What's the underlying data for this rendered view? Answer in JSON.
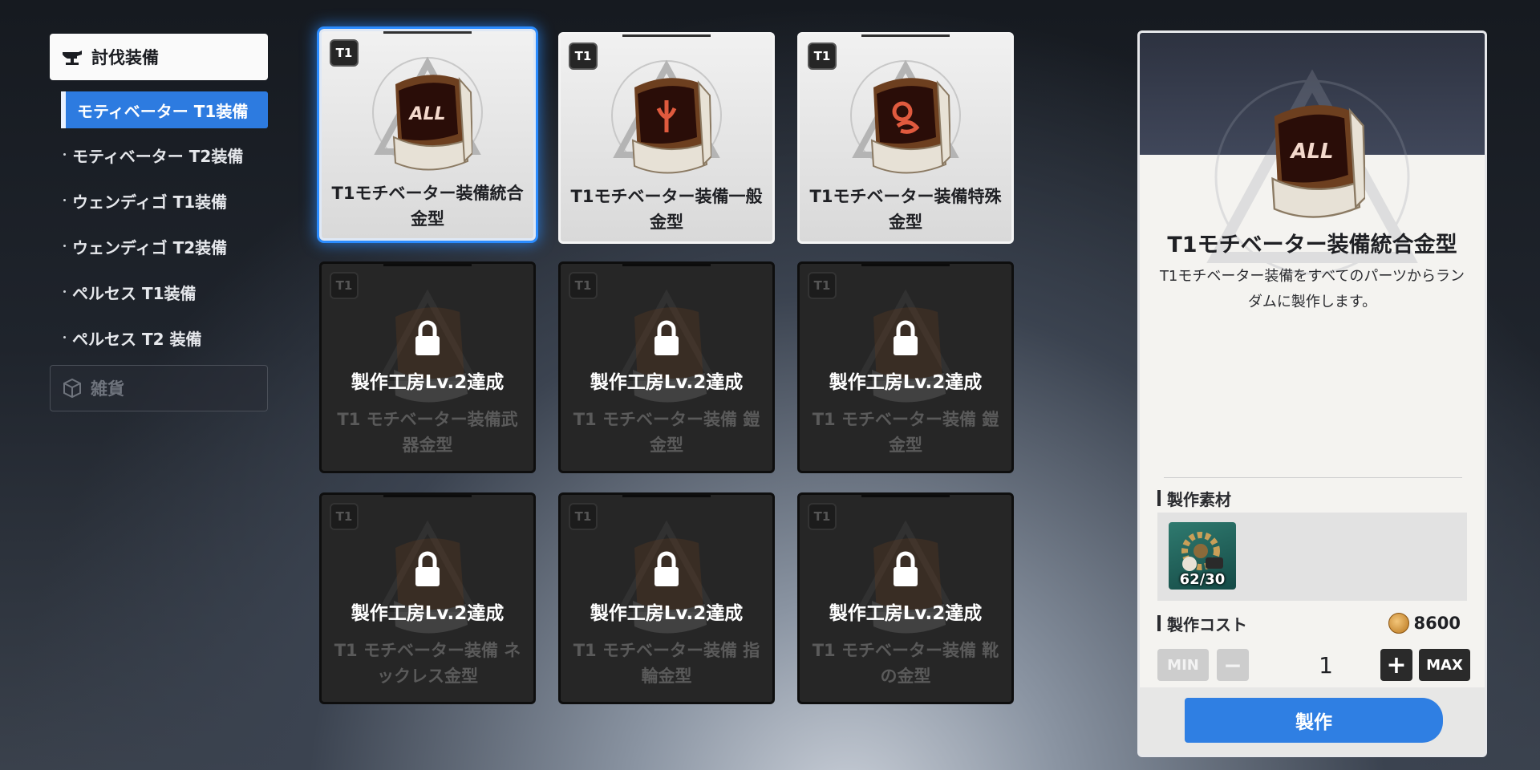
{
  "sidebar": {
    "category_active": "討伐装備",
    "items": [
      {
        "label": "モティベーター T1装備",
        "active": true
      },
      {
        "label": "モティベーター T2装備",
        "active": false
      },
      {
        "label": "ウェンディゴ T1装備",
        "active": false
      },
      {
        "label": "ウェンディゴ T2装備",
        "active": false
      },
      {
        "label": "ペルセス T1装備",
        "active": false
      },
      {
        "label": "ペルセス T2 装備",
        "active": false
      }
    ],
    "category_inactive": "雑貨"
  },
  "grid": {
    "cards": [
      {
        "tier": "T1",
        "title": "T1モチベーター装備統合金型",
        "locked": false,
        "selected": true,
        "icon": "all-mold-icon",
        "emblem_text": "ALL"
      },
      {
        "tier": "T1",
        "title": "T1モチベーター装備一般金型",
        "locked": false,
        "selected": false,
        "icon": "general-mold-icon"
      },
      {
        "tier": "T1",
        "title": "T1モチベーター装備特殊金型",
        "locked": false,
        "selected": false,
        "icon": "special-mold-icon"
      },
      {
        "tier": "T1",
        "title": "T1 モチベーター装備武器金型",
        "locked": true,
        "lock_text": "製作工房Lv.2達成"
      },
      {
        "tier": "T1",
        "title": "T1 モチベーター装備 鎧金型",
        "locked": true,
        "lock_text": "製作工房Lv.2達成"
      },
      {
        "tier": "T1",
        "title": "T1 モチベーター装備 鎧金型",
        "locked": true,
        "lock_text": "製作工房Lv.2達成"
      },
      {
        "tier": "T1",
        "title": "T1 モチベーター装備 ネックレス金型",
        "locked": true,
        "lock_text": "製作工房Lv.2達成"
      },
      {
        "tier": "T1",
        "title": "T1 モチベーター装備 指輪金型",
        "locked": true,
        "lock_text": "製作工房Lv.2達成"
      },
      {
        "tier": "T1",
        "title": "T1 モチベーター装備 靴の金型",
        "locked": true,
        "lock_text": "製作工房Lv.2達成"
      }
    ]
  },
  "panel": {
    "emblem_text": "ALL",
    "title": "T1モチベーター装備統合金型",
    "description": "T1モチベーター装備をすべてのパーツからランダムに製作します。",
    "materials_label": "製作素材",
    "material": {
      "count": "62/30",
      "icon": "gear-material-icon"
    },
    "cost_label": "製作コスト",
    "cost_value": "8600",
    "min_label": "MIN",
    "minus_label": "−",
    "quantity": "1",
    "plus_label": "+",
    "max_label": "MAX",
    "craft_label": "製作"
  },
  "colors": {
    "accent_blue": "#2f7fe3",
    "selected_glow": "#2b8cff"
  }
}
